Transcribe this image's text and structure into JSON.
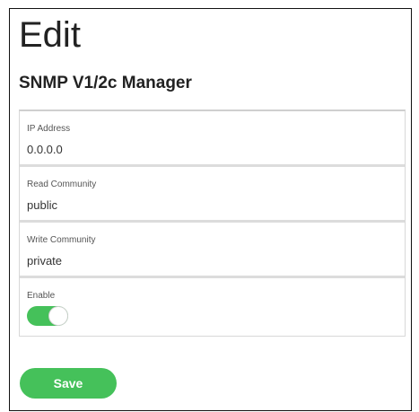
{
  "page": {
    "title": "Edit",
    "section_title": "SNMP V1/2c Manager"
  },
  "form": {
    "fields": [
      {
        "label": "IP Address",
        "value": "0.0.0.0"
      },
      {
        "label": "Read Community",
        "value": "public"
      },
      {
        "label": "Write Community",
        "value": "private"
      }
    ],
    "enable": {
      "label": "Enable",
      "on": true
    }
  },
  "actions": {
    "save_label": "Save"
  },
  "colors": {
    "accent": "#45c15a",
    "text": "#222222",
    "border": "#d8d8d8"
  }
}
